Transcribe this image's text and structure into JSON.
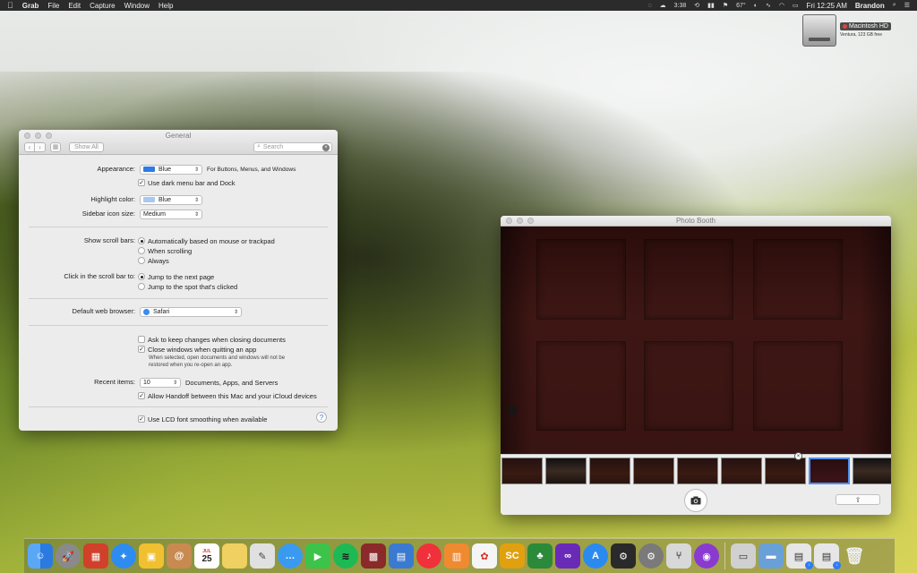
{
  "menubar": {
    "app": "Grab",
    "items": [
      "File",
      "Edit",
      "Capture",
      "Window",
      "Help"
    ],
    "status": [
      "3:38",
      "67°",
      "Fri 12:25 AM",
      "Brandon"
    ]
  },
  "desktop": {
    "disk_name": "Macintosh HD",
    "disk_sub": "Ventura, 123 GB free"
  },
  "general": {
    "title": "General",
    "show_all": "Show All",
    "search_placeholder": "Search",
    "appearance_label": "Appearance:",
    "appearance_value": "Blue",
    "appearance_note": "For Buttons, Menus, and Windows",
    "dark_menu_label": "Use dark menu bar and Dock",
    "highlight_label": "Highlight color:",
    "highlight_value": "Blue",
    "sidebar_label": "Sidebar icon size:",
    "sidebar_value": "Medium",
    "scrollbars_label": "Show scroll bars:",
    "scroll_opt1": "Automatically based on mouse or trackpad",
    "scroll_opt2": "When scrolling",
    "scroll_opt3": "Always",
    "click_label": "Click in the scroll bar to:",
    "click_opt1": "Jump to the next page",
    "click_opt2": "Jump to the spot that's clicked",
    "browser_label": "Default web browser:",
    "browser_value": "Safari",
    "ask_changes": "Ask to keep changes when closing documents",
    "close_windows": "Close windows when quitting an app",
    "close_note1": "When selected, open documents and windows will not be",
    "close_note2": "restored when you re-open an app.",
    "recent_label": "Recent items:",
    "recent_value": "10",
    "recent_note": "Documents, Apps, and Servers",
    "handoff": "Allow Handoff between this Mac and your iCloud devices",
    "lcd": "Use LCD font smoothing when available",
    "help": "?"
  },
  "photobooth": {
    "title": "Photo Booth",
    "thumb_count": 9,
    "selected_thumb": 7
  },
  "dock": {
    "apps": [
      "Finder",
      "Launchpad",
      "Mission Control",
      "Safari",
      "Preview",
      "Contacts",
      "Calendar",
      "Notes",
      "TextEdit",
      "Messages",
      "FaceTime",
      "Spotify",
      "Photo Booth",
      "Preview",
      "Music",
      "Books",
      "Photos",
      "SC",
      "Evernote",
      "Visual Studio",
      "App Store",
      "Steam",
      "System Preferences",
      "Fork",
      "Podcasts"
    ],
    "calendar_day": "25",
    "calendar_month": "JUL",
    "accent_colors": [
      "#3a8cf0",
      "#8a8a8a",
      "#d0402a",
      "#2e8cf0",
      "#f0c030",
      "#c88a50",
      "#ffffff",
      "#f0d060",
      "#e0e0e0",
      "#3a9af0",
      "#3cc44a",
      "#1db954",
      "#8a2a2a",
      "#3a7ad0",
      "#f0303a",
      "#f08a30",
      "#f5f5f5",
      "#e0a010",
      "#2a8a3a",
      "#6a2ab8",
      "#2a8af0",
      "#2a2a2a",
      "#7a7a7a",
      "#d8d8d8",
      "#8a3ad0"
    ]
  }
}
